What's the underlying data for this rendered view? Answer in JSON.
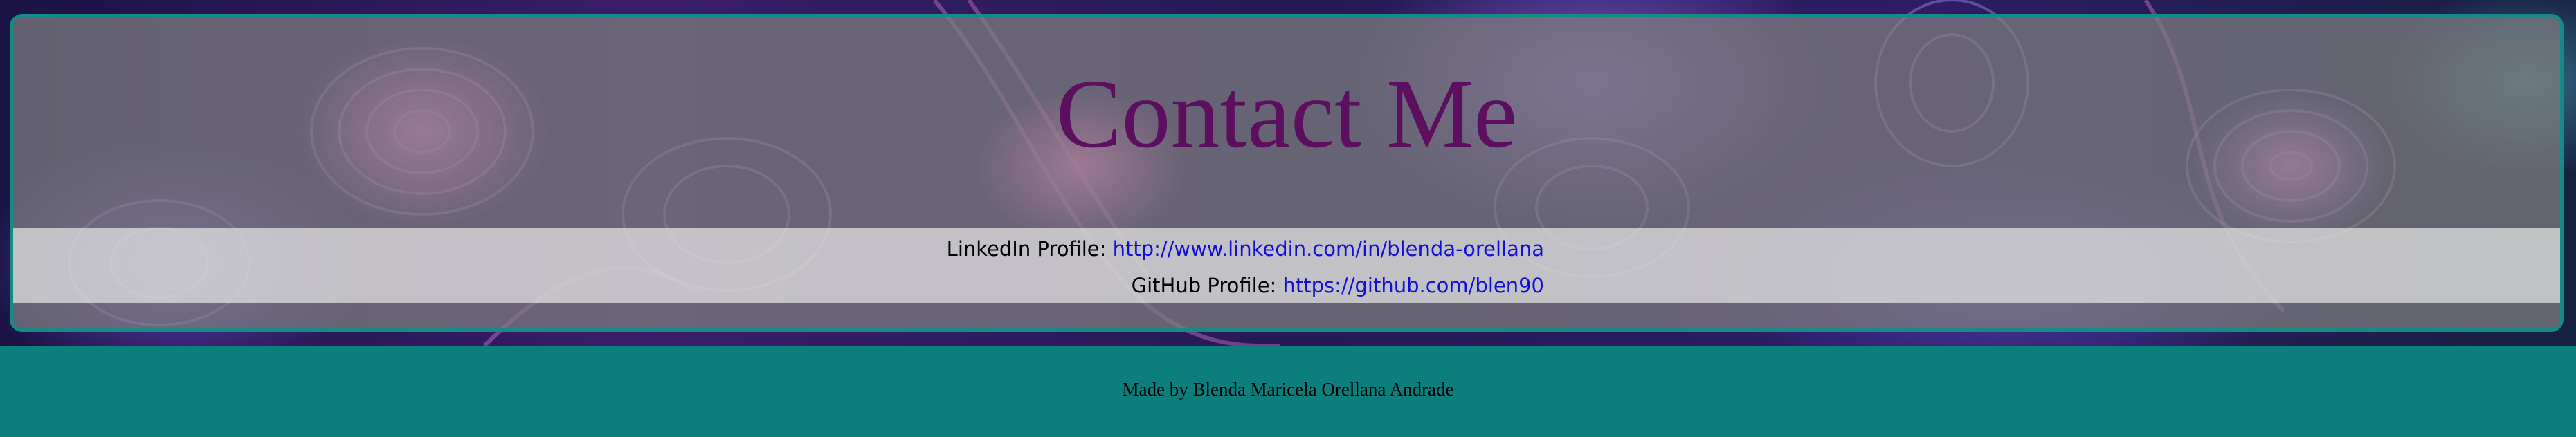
{
  "header": {
    "title": "Contact Me"
  },
  "contacts": {
    "linkedin_label": "LinkedIn Profile:",
    "linkedin_url": "http://www.linkedin.com/in/blenda-orellana",
    "github_label": "GitHub Profile:",
    "github_url": "https://github.com/blen90"
  },
  "footer": {
    "text": "Made by Blenda Maricela Orellana Andrade"
  },
  "colors": {
    "title": "#5c0f5e",
    "card_border": "#178a86",
    "footer_bg": "#0c7e7c",
    "link": "#0f0fd8"
  }
}
